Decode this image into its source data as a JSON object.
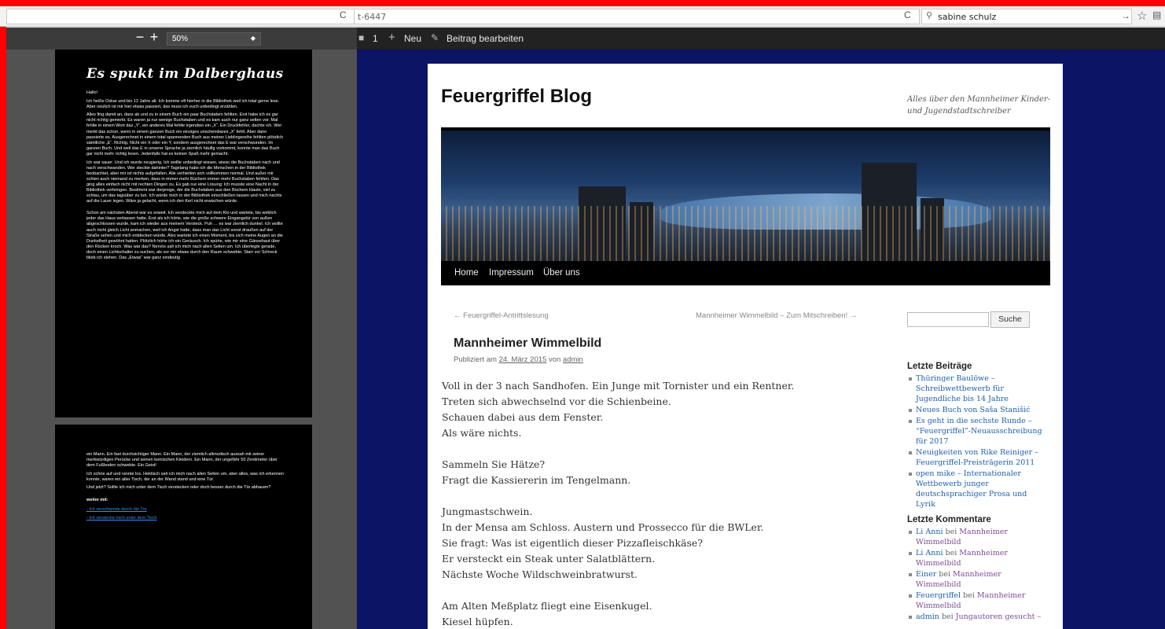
{
  "browser": {
    "url_fragment": "t-6447",
    "search_query": "sabine schulz"
  },
  "pdf": {
    "zoom": "50%",
    "title": "Es spukt im Dalberghaus",
    "page1": [
      "Hallo!",
      "Ich heiße Oskar und bin 12 Jahre alt. Ich komme oft hierher in die Bibliothek weil ich total gerne lese. Aber neulich ist mir hier etwas passiert, das muss ich euch unbedingt erzählen.",
      "Alles fing damit an, dass ab und zu in einem Buch ein paar Buchstaben fehlten. Erst habe ich es gar nicht richtig gemerkt. Es waren ja nur wenige Buchstaben und es kam auch nur ganz selten vor. Mal fehlte in einem Wort das „Y“, ein anderes Mal fehlte irgendwo ein „X“. Ein Druckfehler, dachte ich. Wer merkt das schon, wenn in einem ganzen Buch ein einziges unscheinbares „X“ fehlt. Aber dann passierte es. Ausgerechnet in einem total spannenden Buch aus meiner Lieblingsreihe fehlten plötzlich sämtliche „E“. Richtig. Nicht ein X oder ein Y, sondern ausgerechnet das E war verschwunden. Im ganzen Buch. Und weil das E in unserer Sprache ja ziemlich häufig vorkommt, konnte man das Buch gar nicht mehr richtig lesen. Jedenfalls hat es keinen Spaß mehr gemacht.",
      "Ich war sauer. Und ich wurde neugierig. Ich wollte unbedingt wissen, wieso die Buchstaben nach und nach verschwanden. Wer steckte dahinter? Tagelang habe ich die Menschen in der Bibliothek beobachtet, aber mir ist nichts aufgefallen. Alle verhielten sich vollkommen normal. Und außer mir schien auch niemand zu merken, dass in immer mehr Büchern immer mehr Buchstaben fehlten. Das ging alles einfach nicht mit rechten Dingen zu. Es gab nur eine Lösung: Ich musste eine Nacht in der Bibliothek verbringen. Bestimmt war derjenige, der die Buchstaben aus den Büchern klaute, viel zu schlau, um das tagsüber zu tun. Ich würde mich in der Bibliothek einschließen lassen und mich nachts auf die Lauer legen. Wäre ja gelacht, wenn ich den Kerl nicht erwischen würde.",
      "Schon am nächsten Abend war es soweit. Ich versteckte mich auf dem Klo und wartete, bis wirklich jeder das Haus verlassen hatte. Erst als ich hörte, wie die große schwere Eingangstür von außen abgeschlossen wurde, kam ich wieder aus meinem Versteck. Puh … es war ziemlich dunkel. Ich wollte auch nicht gleich Licht anmachen, weil ich Angst hatte, dass man das Licht sonst draußen auf der Straße sehen und mich entdecken würde. Also wartete ich einen Moment, bis sich meine Augen an die Dunkelheit gewöhnt hatten. Plötzlich hörte ich ein Geräusch. Ich spürte, wie mir eine Gänsehaut über den Rücken kroch. Was war das? Nervös sah ich mich nach allen Seiten um. Ich überlegte gerade, doch einen Lichtschalter zu suchen, als vor mir etwas durch den Raum schwebte. Starr vor Schreck blieb ich stehen. Das „Etwas“ war ganz eindeutig"
    ],
    "page2": [
      "ein Mann. Ein fast durchsichtiger Mann. Ein Mann, der ziemlich altmodisch aussah mit seiner merkwürdigen Perücke und seinen komischen Kleidern. Ein Mann, der ungefähr 50 Zentimeter über dem Fußboden schwebte. Ein Geist!",
      "Ich schrie auf und rannte los. Hektisch sah ich mich nach allen Seiten um, aber alles, was ich erkennen konnte, waren ein alter Tisch, der an der Wand stand und eine Tür.",
      "Und jetzt? Sollte ich mich unter dem Tisch verstecken oder doch besser durch die Tür abhauen?"
    ],
    "continue_heading": "weiter mit:",
    "continue_links": [
      "- Ich verschwinde durch die Tür",
      "- Ich verstecke mich unter dem Tisch"
    ]
  },
  "adminbar": {
    "comments_count": "1",
    "new_label": "Neu",
    "edit_label": "Beitrag bearbeiten"
  },
  "site": {
    "title": "Feuergriffel Blog",
    "description": "Alles über den Mannheimer Kinder- und Jugendstadtschreiber",
    "nav": [
      "Home",
      "Impressum",
      "Über uns"
    ]
  },
  "post": {
    "prev": "← Feuergriffel-Antrittslesung",
    "next": "Mannheimer Wimmelbild – Zum Mitschreiben! →",
    "title": "Mannheimer Wimmelbild",
    "meta_prefix": "Publiziert am",
    "date": "24. März 2015",
    "meta_by": "von",
    "author": "admin",
    "lines": [
      "Voll in der 3 nach Sandhofen. Ein Junge mit Tornister und ein Rentner.",
      "Treten sich abwechselnd vor die Schienbeine.",
      "Schauen dabei aus dem Fenster.",
      "Als wäre nichts.",
      "",
      "Sammeln Sie Hätze?",
      "Fragt die Kassiererin im Tengelmann.",
      "",
      "Jungmastschwein.",
      "In der Mensa am Schloss. Austern und Prossecco für die BWLer.",
      "Sie fragt: Was ist eigentlich dieser Pizzafleischkäse?",
      "Er versteckt ein Steak unter Salatblättern.",
      "Nächste Woche Wildschweinbratwurst.",
      "",
      "Am Alten Meßplatz fliegt eine Eisenkugel.",
      "Kiesel hüpfen."
    ]
  },
  "sidebar": {
    "search_button": "Suche",
    "recent_posts_title": "Letzte Beiträge",
    "recent_posts": [
      "Thüringer Baulöwe – Schreibwettbewerb für Jugendliche bis 14 Jahre",
      "Neues Buch von Saša Stanišić",
      "Es geht in die sechste Runde – “Feuergriffel”-Neuausschreibung für 2017",
      "Neuigkeiten von Rike Reiniger – Feuergriffel-Preisträgerin 2011",
      "open mike – Internationaler Wettbewerb junger deutschsprachiger Prosa und Lyrik"
    ],
    "recent_comments_title": "Letzte Kommentare",
    "recent_comments": [
      {
        "author": "Li Anni",
        "sep": " bei ",
        "post": "Mannheimer Wimmelbild"
      },
      {
        "author": "Li Anni",
        "sep": " bei ",
        "post": "Mannheimer Wimmelbild"
      },
      {
        "author": "Einer",
        "sep": " bei ",
        "post": "Mannheimer Wimmelbild"
      },
      {
        "author": "Feuergriffel",
        "sep": " bei ",
        "post": "Mannheimer Wimmelbild"
      },
      {
        "author": "admin",
        "sep": " bei ",
        "post": "Jungautoren gesucht –"
      }
    ]
  }
}
